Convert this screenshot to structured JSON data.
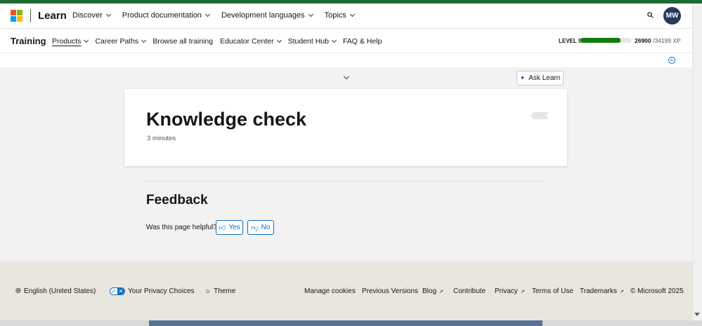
{
  "global_header": {
    "brand": "Learn",
    "nav": [
      {
        "label": "Discover"
      },
      {
        "label": "Product documentation"
      },
      {
        "label": "Development languages"
      },
      {
        "label": "Topics"
      }
    ],
    "avatar_initials": "MW"
  },
  "sub_header": {
    "title": "Training",
    "nav": [
      {
        "label": "Products",
        "has_menu": true,
        "active": true
      },
      {
        "label": "Career Paths",
        "has_menu": true
      },
      {
        "label": "Browse all training",
        "has_menu": false
      },
      {
        "label": "Educator Center",
        "has_menu": true
      },
      {
        "label": "Student Hub",
        "has_menu": true
      },
      {
        "label": "FAQ & Help",
        "has_menu": false
      }
    ],
    "level": "LEVEL 9",
    "xp_current": "26900",
    "xp_total": "/34199 XP",
    "xp_progress_fraction": 0.787
  },
  "ask_learn_label": "Ask Learn",
  "content": {
    "title": "Knowledge check",
    "duration": "3 minutes"
  },
  "feedback": {
    "title": "Feedback",
    "question": "Was this page helpful?",
    "yes_label": "Yes",
    "no_label": "No"
  },
  "footer": {
    "language": "English (United States)",
    "privacy": "Your Privacy Choices",
    "theme": "Theme",
    "links": {
      "manage_cookies": "Manage cookies",
      "previous_versions": "Previous Versions",
      "blog": "Blog",
      "contribute": "Contribute",
      "privacy": "Privacy",
      "terms": "Terms of Use",
      "trademarks": "Trademarks",
      "copyright": "© Microsoft 2025"
    }
  },
  "colors": {
    "accent": "#0f6cbd",
    "progress": "#107c10",
    "avatar_bg": "#243a5e",
    "footer_bg": "#e9e6df"
  }
}
